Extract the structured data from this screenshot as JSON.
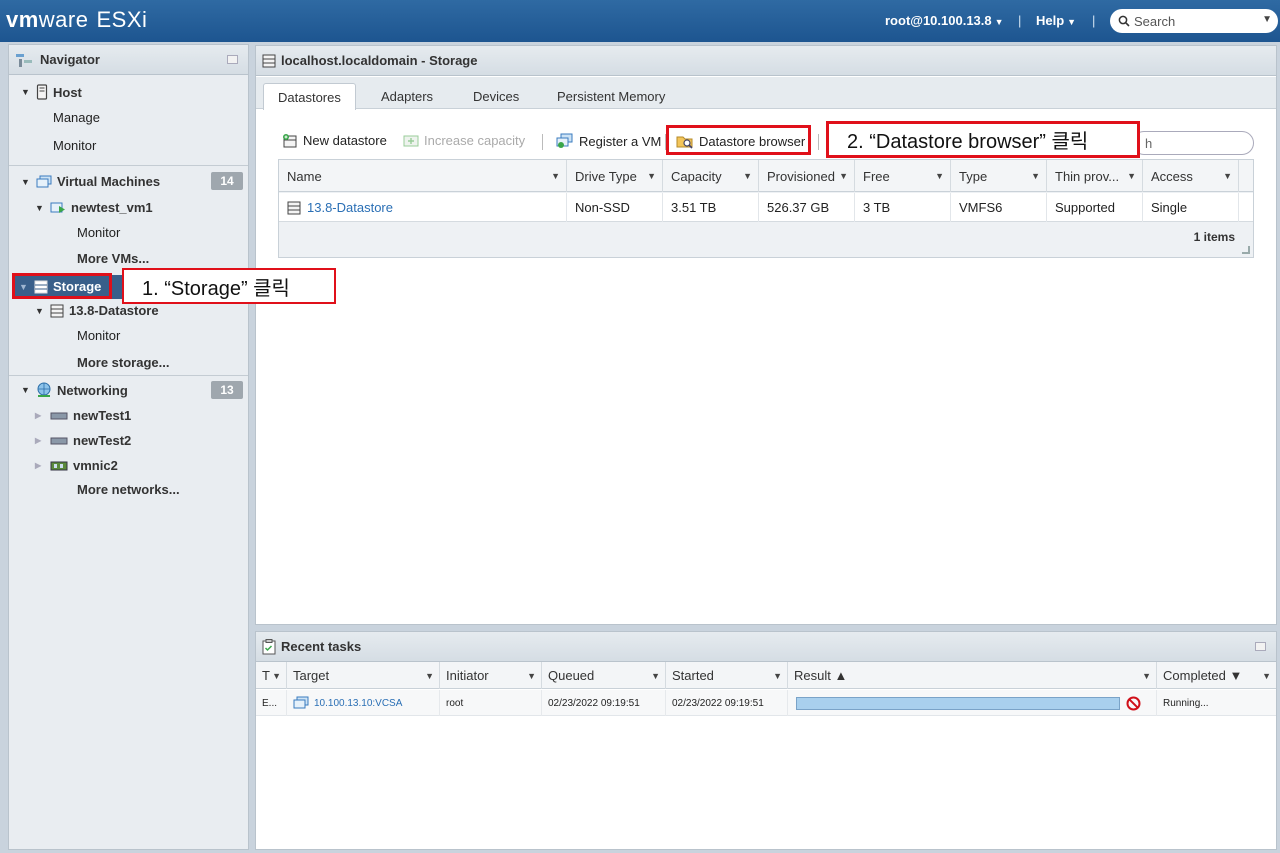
{
  "topbar": {
    "logo_vm": "vm",
    "logo_ware": "ware",
    "logo_esxi": "ESXi",
    "user": "root@10.100.13.8",
    "help": "Help",
    "search_placeholder": "Search"
  },
  "navigator": {
    "title": "Navigator",
    "host": {
      "label": "Host",
      "manage": "Manage",
      "monitor": "Monitor"
    },
    "vms": {
      "label": "Virtual Machines",
      "count": "14",
      "vm_name": "newtest_vm1",
      "vm_monitor": "Monitor",
      "more": "More VMs..."
    },
    "storage": {
      "label": "Storage",
      "datastore": "13.8-Datastore",
      "ds_monitor": "Monitor",
      "more": "More storage..."
    },
    "networking": {
      "label": "Networking",
      "count": "13",
      "items": [
        "newTest1",
        "newTest2",
        "vmnic2"
      ],
      "more": "More networks..."
    }
  },
  "main": {
    "title": "localhost.localdomain - Storage",
    "tabs": [
      "Datastores",
      "Adapters",
      "Devices",
      "Persistent Memory"
    ],
    "toolbar": {
      "new_datastore": "New datastore",
      "increase_capacity": "Increase capacity",
      "register_vm": "Register a VM",
      "datastore_browser": "Datastore browser",
      "filter_tail": "h"
    },
    "grid": {
      "columns": [
        "Name",
        "Drive Type",
        "Capacity",
        "Provisioned",
        "Free",
        "Type",
        "Thin prov...",
        "Access"
      ],
      "row": [
        "13.8-Datastore",
        "Non-SSD",
        "3.51 TB",
        "526.37 GB",
        "3 TB",
        "VMFS6",
        "Supported",
        "Single"
      ],
      "footer": "1 items"
    }
  },
  "tasks": {
    "title": "Recent tasks",
    "columns": [
      "T",
      "Target",
      "Initiator",
      "Queued",
      "Started",
      "Result ▲",
      "Completed ▼"
    ],
    "row": {
      "t": "E...",
      "target": "10.100.13.10:VCSA",
      "initiator": "root",
      "queued": "02/23/2022 09:19:51",
      "started": "02/23/2022 09:19:51",
      "completed": "Running...",
      "progress": 1.0
    }
  },
  "annotations": {
    "step1": "1. “Storage” 클릭",
    "step2": "2. “Datastore browser” 클릭",
    "color": "#e0101a"
  }
}
